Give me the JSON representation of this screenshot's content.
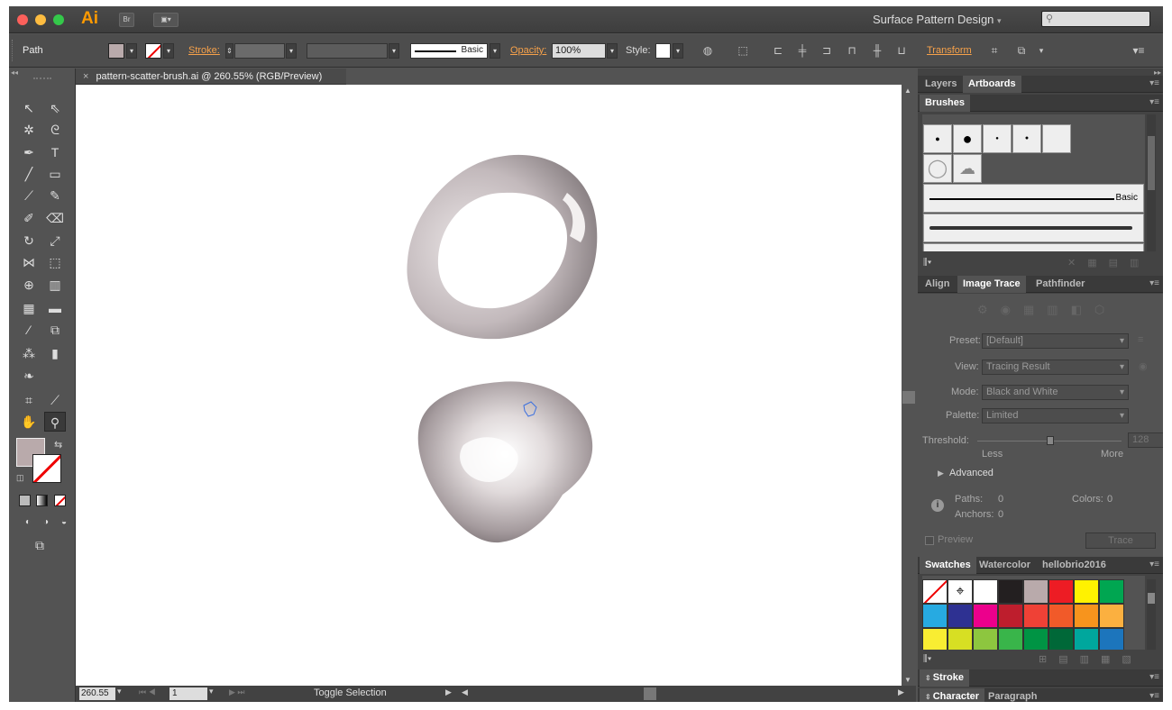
{
  "app": {
    "logo": "Ai",
    "bridge_label": "Br",
    "workspace": "Surface Pattern Design",
    "workspace_caret": "▾"
  },
  "control": {
    "object_type": "Path",
    "stroke_label": "Stroke:",
    "brush_label": "Basic",
    "opacity_label": "Opacity:",
    "opacity_value": "100%",
    "style_label": "Style:",
    "transform_label": "Transform"
  },
  "document": {
    "tab_title": "pattern-scatter-brush.ai @ 260.55% (RGB/Preview)",
    "close": "×"
  },
  "status": {
    "zoom": "260.55",
    "page": "1",
    "tool_hint": "Toggle Selection"
  },
  "panels": {
    "top_tabs": [
      "Layers",
      "Artboards"
    ],
    "brushes": {
      "tab": "Brushes",
      "basic_label": "Basic"
    },
    "trace_tabs": [
      "Align",
      "Image Trace",
      "Pathfinder"
    ],
    "image_trace": {
      "preset_label": "Preset:",
      "preset_value": "[Default]",
      "view_label": "View:",
      "view_value": "Tracing Result",
      "mode_label": "Mode:",
      "mode_value": "Black and White",
      "palette_label": "Palette:",
      "palette_value": "Limited",
      "threshold_label": "Threshold:",
      "threshold_value": "128",
      "less": "Less",
      "more": "More",
      "advanced": "Advanced",
      "paths_label": "Paths:",
      "paths_value": "0",
      "colors_label": "Colors:",
      "colors_value": "0",
      "anchors_label": "Anchors:",
      "anchors_value": "0",
      "preview_label": "Preview",
      "trace_button": "Trace"
    },
    "swatch_tabs": [
      "Swatches",
      "Watercolor",
      "hellobrio2016"
    ],
    "swatch_colors": [
      "#ffffff",
      "#231f20",
      "#b9aaab",
      "#ed1c24",
      "#fff200",
      "#00a651",
      "#27aae1",
      "#2e3192",
      "#ec008c",
      "#be1e2d",
      "#ef4136",
      "#f15a29",
      "#f7941d",
      "#fbb040",
      "#f9ed32",
      "#d7df23",
      "#8dc63f",
      "#39b54a",
      "#009444",
      "#006838",
      "#00a79d",
      "#1c75bc"
    ],
    "stroke_tab": "Stroke",
    "char_tabs": [
      "Character",
      "Paragraph"
    ]
  },
  "colors": {
    "accent": "#ff9a00",
    "link": "#f6a14a",
    "panel_bg": "#434343"
  }
}
